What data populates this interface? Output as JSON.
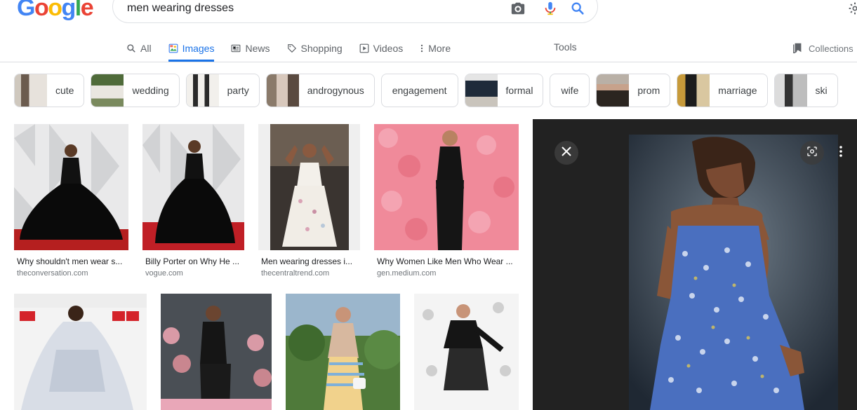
{
  "logo": {
    "letters": [
      "G",
      "o",
      "o",
      "g",
      "l",
      "e"
    ],
    "colors": [
      "#4285f4",
      "#ea4335",
      "#fbbc05",
      "#4285f4",
      "#34a853",
      "#ea4335"
    ]
  },
  "search": {
    "query": "men wearing dresses"
  },
  "tabs": [
    {
      "label": "All",
      "icon": "search-icon"
    },
    {
      "label": "Images",
      "icon": "image-icon",
      "active": true
    },
    {
      "label": "News",
      "icon": "news-icon"
    },
    {
      "label": "Shopping",
      "icon": "tag-icon"
    },
    {
      "label": "Videos",
      "icon": "play-icon"
    },
    {
      "label": "More",
      "icon": "more-vert-icon"
    }
  ],
  "tools_label": "Tools",
  "collections_label": "Collections",
  "chips": [
    {
      "label": "cute",
      "has_image": true
    },
    {
      "label": "wedding",
      "has_image": true
    },
    {
      "label": "party",
      "has_image": true
    },
    {
      "label": "androgynous",
      "has_image": true
    },
    {
      "label": "engagement",
      "has_image": false
    },
    {
      "label": "formal",
      "has_image": true
    },
    {
      "label": "wife",
      "has_image": false
    },
    {
      "label": "prom",
      "has_image": true
    },
    {
      "label": "marriage",
      "has_image": true
    },
    {
      "label": "ski",
      "has_image": true
    }
  ],
  "results": [
    {
      "title": "Why shouldn't men wear s...",
      "source": "theconversation.com"
    },
    {
      "title": "Billy Porter on Why He ...",
      "source": "vogue.com"
    },
    {
      "title": "Men wearing dresses i...",
      "source": "thecentraltrend.com"
    },
    {
      "title": "Why Women Like Men Who Wear ...",
      "source": "gen.medium.com"
    },
    {
      "title": "",
      "source": ""
    },
    {
      "title": "",
      "source": ""
    },
    {
      "title": "",
      "source": ""
    },
    {
      "title": "",
      "source": ""
    }
  ],
  "colors": {
    "accent": "#1a73e8",
    "preview_bg": "#222222"
  }
}
